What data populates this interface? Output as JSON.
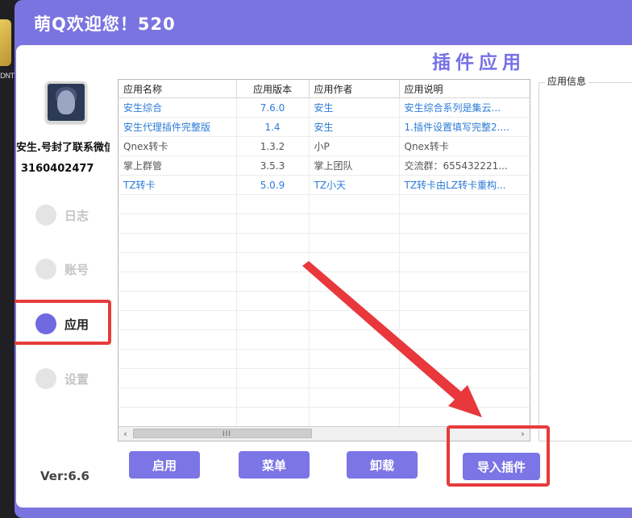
{
  "background": {
    "side_text": "DNT"
  },
  "window": {
    "title": "萌Q欢迎您！520"
  },
  "section": {
    "title": "插件应用"
  },
  "user": {
    "name": "安生.号封了联系微信",
    "id": "3160402477"
  },
  "nav": [
    {
      "label": "日志",
      "active": false
    },
    {
      "label": "账号",
      "active": false
    },
    {
      "label": "应用",
      "active": true
    },
    {
      "label": "设置",
      "active": false
    }
  ],
  "table": {
    "columns": [
      "应用名称",
      "应用版本",
      "应用作者",
      "应用说明"
    ],
    "rows": [
      {
        "name": "安生综合",
        "version": "7.6.0",
        "author": "安生",
        "desc": "安生综合系列是集云...",
        "color": "blue"
      },
      {
        "name": "安生代理插件完整版",
        "version": "1.4",
        "author": "安生",
        "desc": "1.插件设置填写完整2....",
        "color": "blue"
      },
      {
        "name": "Qnex转卡",
        "version": "1.3.2",
        "author": "小P",
        "desc": "Qnex转卡",
        "color": "gray"
      },
      {
        "name": "掌上群管",
        "version": "3.5.3",
        "author": "掌上团队",
        "desc": "交流群：655432221...",
        "color": "gray"
      },
      {
        "name": "TZ转卡",
        "version": "5.0.9",
        "author": "TZ小天",
        "desc": "TZ转卡由LZ转卡重构...",
        "color": "blue"
      }
    ],
    "scroll_grip": "III"
  },
  "info": {
    "title": "应用信息"
  },
  "buttons": {
    "enable": "启用",
    "menu": "菜单",
    "uninstall": "卸载",
    "import": "导入插件"
  },
  "version": "Ver:6.6",
  "colors": {
    "accent": "#7b75e5",
    "highlight": "#e63b3b",
    "link_blue": "#2b7bd6"
  }
}
